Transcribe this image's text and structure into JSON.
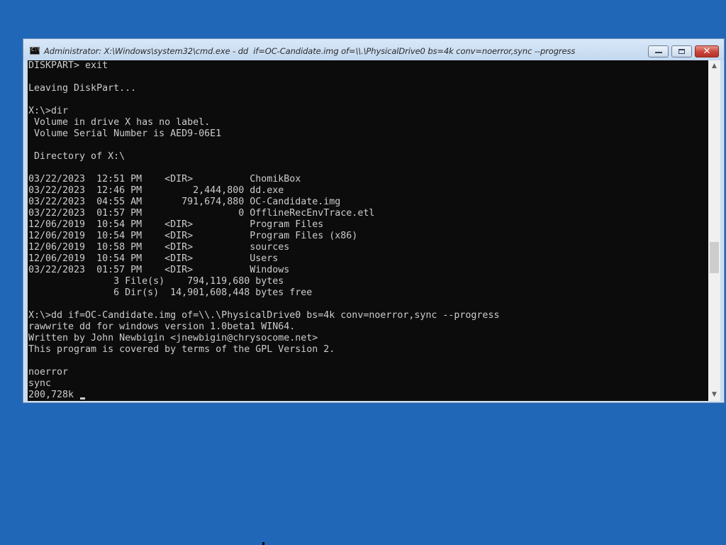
{
  "window": {
    "title": "Administrator: X:\\Windows\\system32\\cmd.exe - dd  if=OC-Candidate.img of=\\\\.\\PhysicalDrive0 bs=4k conv=noerror,sync --progress",
    "icon": "cmd-icon",
    "icon_glyph": "C:\\",
    "buttons": {
      "minimize": "minimize-icon",
      "maximize": "maximize-icon",
      "close": "close-icon",
      "close_glyph": "✕"
    }
  },
  "console": {
    "background": "#0c0c0c",
    "foreground": "#cccccc",
    "lines": [
      "DISKPART> exit",
      "",
      "Leaving DiskPart...",
      "",
      "X:\\>dir",
      " Volume in drive X has no label.",
      " Volume Serial Number is AED9-06E1",
      "",
      " Directory of X:\\",
      "",
      "03/22/2023  12:51 PM    <DIR>          ChomikBox",
      "03/22/2023  12:46 PM         2,444,800 dd.exe",
      "03/22/2023  04:55 AM       791,674,880 OC-Candidate.img",
      "03/22/2023  01:57 PM                 0 OfflineRecEnvTrace.etl",
      "12/06/2019  10:54 PM    <DIR>          Program Files",
      "12/06/2019  10:54 PM    <DIR>          Program Files (x86)",
      "12/06/2019  10:58 PM    <DIR>          sources",
      "12/06/2019  10:54 PM    <DIR>          Users",
      "03/22/2023  01:57 PM    <DIR>          Windows",
      "               3 File(s)    794,119,680 bytes",
      "               6 Dir(s)  14,901,608,448 bytes free",
      "",
      "X:\\>dd if=OC-Candidate.img of=\\\\.\\PhysicalDrive0 bs=4k conv=noerror,sync --progress",
      "rawwrite dd for windows version 1.0beta1 WIN64.",
      "Written by John Newbigin <jnewbigin@chrysocome.net>",
      "This program is covered by terms of the GPL Version 2.",
      "",
      "noerror",
      "sync",
      "200,728k "
    ]
  },
  "scrollbar": {
    "up_glyph": "▲",
    "down_glyph": "▼"
  },
  "desktop": {
    "background": "#2167b8"
  }
}
